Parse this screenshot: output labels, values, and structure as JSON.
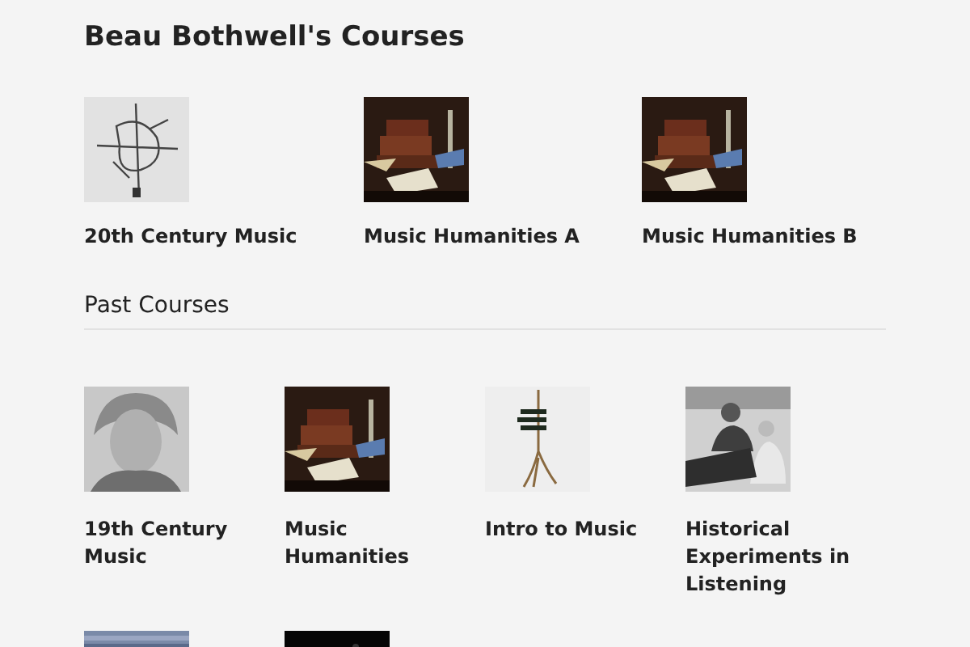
{
  "page_title": "Beau Bothwell's Courses",
  "current_courses": [
    {
      "title": "20th Century Music",
      "image": {
        "kind": "picture"
      }
    },
    {
      "title": "Music Humanities A",
      "image": {
        "kind": "picture"
      }
    },
    {
      "title": "Music Humanities B",
      "image": {
        "kind": "picture"
      }
    }
  ],
  "past_courses": {
    "heading": "Past Courses",
    "courses": [
      {
        "title": "19th Century Music",
        "image": {
          "kind": "picture"
        }
      },
      {
        "title": "Music Humanities",
        "image": {
          "kind": "picture"
        }
      },
      {
        "title": "Intro to Music",
        "image": {
          "kind": "picture"
        }
      },
      {
        "title": "Historical Experiments in Listening",
        "image": {
          "kind": "picture"
        }
      },
      {
        "image": {
          "kind": "picture"
        }
      },
      {
        "image": {
          "kind": "picture"
        }
      }
    ]
  }
}
